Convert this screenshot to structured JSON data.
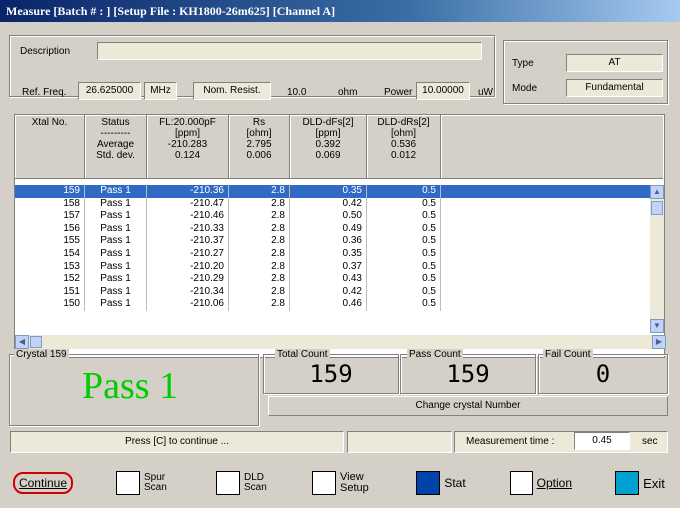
{
  "window": {
    "title": "Measure [Batch # : ] [Setup File : KH1800-26m625] [Channel A]"
  },
  "info": {
    "description_label": "Description",
    "description_value": "",
    "ref_freq_label": "Ref. Freq.",
    "ref_freq_value": "26.625000",
    "ref_freq_unit": "MHz",
    "nom_resist_label": "Nom. Resist.",
    "nom_resist_value": "10.0",
    "nom_resist_unit": "ohm",
    "power_label": "Power",
    "power_value": "10.00000",
    "power_unit": "uW",
    "type_label": "Type",
    "type_value": "AT",
    "mode_label": "Mode",
    "mode_value": "Fundamental"
  },
  "table": {
    "headers": [
      {
        "l1": "Xtal No.",
        "l2": "",
        "l3": "",
        "l4": ""
      },
      {
        "l1": "Status",
        "l2": "---------",
        "l3": "Average",
        "l4": "Std. dev."
      },
      {
        "l1": "FL:20.000pF",
        "l2": "[ppm]",
        "l3": "-210.283",
        "l4": "0.124"
      },
      {
        "l1": "Rs",
        "l2": "[ohm]",
        "l3": "2.795",
        "l4": "0.006"
      },
      {
        "l1": "DLD-dFs[2]",
        "l2": "[ppm]",
        "l3": "0.392",
        "l4": "0.069"
      },
      {
        "l1": "DLD-dRs[2]",
        "l2": "[ohm]",
        "l3": "0.536",
        "l4": "0.012"
      }
    ],
    "rows": [
      [
        "159",
        "Pass 1",
        "-210.36",
        "2.8",
        "0.35",
        "0.5"
      ],
      [
        "158",
        "Pass 1",
        "-210.47",
        "2.8",
        "0.42",
        "0.5"
      ],
      [
        "157",
        "Pass 1",
        "-210.46",
        "2.8",
        "0.50",
        "0.5"
      ],
      [
        "156",
        "Pass 1",
        "-210.33",
        "2.8",
        "0.49",
        "0.5"
      ],
      [
        "155",
        "Pass 1",
        "-210.37",
        "2.8",
        "0.36",
        "0.5"
      ],
      [
        "154",
        "Pass 1",
        "-210.27",
        "2.8",
        "0.35",
        "0.5"
      ],
      [
        "153",
        "Pass 1",
        "-210.20",
        "2.8",
        "0.37",
        "0.5"
      ],
      [
        "152",
        "Pass 1",
        "-210.29",
        "2.8",
        "0.43",
        "0.5"
      ],
      [
        "151",
        "Pass 1",
        "-210.34",
        "2.8",
        "0.42",
        "0.5"
      ],
      [
        "150",
        "Pass 1",
        "-210.06",
        "2.8",
        "0.46",
        "0.5"
      ]
    ]
  },
  "result": {
    "crystal_label": "Crystal 159",
    "status_text": "Pass 1",
    "status_color": "#00cc00",
    "total_label": "Total Count",
    "total_value": "159",
    "pass_label": "Pass Count",
    "pass_value": "159",
    "fail_label": "Fail Count",
    "fail_value": "0",
    "change_button": "Change crystal Number"
  },
  "status_bar": {
    "message": "Press [C] to continue ...",
    "meas_time_label": "Measurement time :",
    "meas_time_value": "0.45",
    "meas_time_unit": "sec"
  },
  "toolbar": {
    "continue": "Continue",
    "spur_scan": "Spur Scan",
    "dld_scan": "DLD Scan",
    "view_setup": "View Setup",
    "stat": "Stat",
    "option": "Option",
    "exit": "Exit"
  }
}
